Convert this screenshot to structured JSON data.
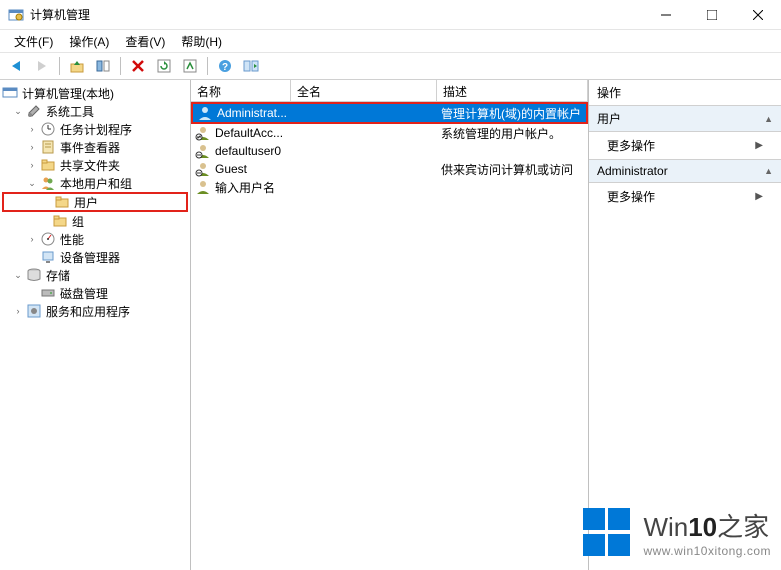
{
  "window": {
    "title": "计算机管理"
  },
  "menu": {
    "file": "文件(F)",
    "action": "操作(A)",
    "view": "查看(V)",
    "help": "帮助(H)"
  },
  "tree": {
    "root": "计算机管理(本地)",
    "system_tools": "系统工具",
    "task_scheduler": "任务计划程序",
    "event_viewer": "事件查看器",
    "shared_folders": "共享文件夹",
    "local_users": "本地用户和组",
    "users": "用户",
    "groups": "组",
    "performance": "性能",
    "device_manager": "设备管理器",
    "storage": "存储",
    "disk_mgmt": "磁盘管理",
    "services_apps": "服务和应用程序"
  },
  "list": {
    "columns": {
      "name": "名称",
      "fullname": "全名",
      "description": "描述"
    },
    "rows": [
      {
        "name": "Administrat...",
        "fullname": "",
        "desc": "管理计算机(域)的内置帐户",
        "selected": true
      },
      {
        "name": "DefaultAcc...",
        "fullname": "",
        "desc": "系统管理的用户帐户。"
      },
      {
        "name": "defaultuser0",
        "fullname": "",
        "desc": ""
      },
      {
        "name": "Guest",
        "fullname": "",
        "desc": "供来宾访问计算机或访问"
      },
      {
        "name": "输入用户名",
        "fullname": "",
        "desc": ""
      }
    ]
  },
  "actions": {
    "title": "操作",
    "section1": "用户",
    "more1": "更多操作",
    "section2": "Administrator",
    "more2": "更多操作"
  },
  "watermark": {
    "brand_prefix": "Win",
    "brand_num": "10",
    "brand_suffix": "之家",
    "url": "www.win10xitong.com"
  }
}
